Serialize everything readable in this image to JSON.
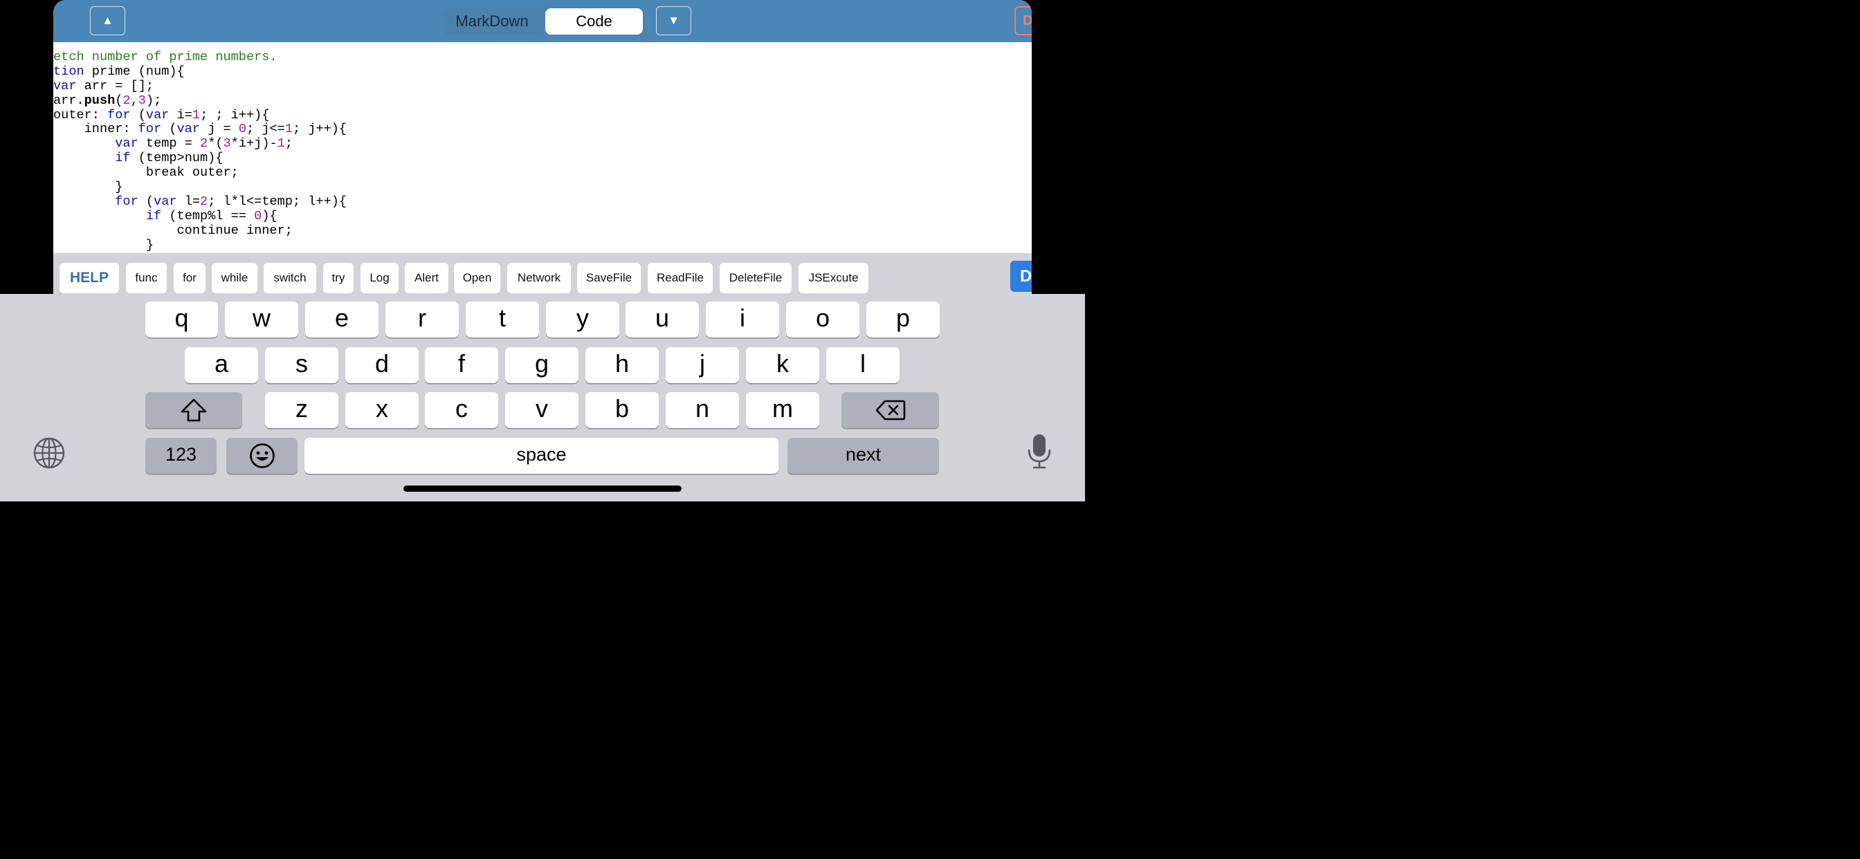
{
  "topbar": {
    "up_arrow": "▲",
    "down_arrow": "▼",
    "segments": [
      "MarkDown",
      "Code"
    ],
    "selected_segment": "Code",
    "corner_button_label": "D"
  },
  "code_lines": [
    [
      {
        "t": "etch number of prime numbers.",
        "c": "cm"
      }
    ],
    [
      {
        "t": "tion",
        "c": "kw"
      },
      {
        "t": " prime (num){",
        "c": ""
      }
    ],
    [
      {
        "t": "var",
        "c": "kw"
      },
      {
        "t": " arr = [];",
        "c": ""
      }
    ],
    [
      {
        "t": "arr.",
        "c": ""
      },
      {
        "t": "push",
        "c": "fn"
      },
      {
        "t": "(",
        "c": ""
      },
      {
        "t": "2",
        "c": "nm"
      },
      {
        "t": ",",
        "c": ""
      },
      {
        "t": "3",
        "c": "nm"
      },
      {
        "t": ");",
        "c": ""
      }
    ],
    [
      {
        "t": "outer: ",
        "c": ""
      },
      {
        "t": "for",
        "c": "kw"
      },
      {
        "t": " (",
        "c": ""
      },
      {
        "t": "var",
        "c": "kw"
      },
      {
        "t": " i=",
        "c": ""
      },
      {
        "t": "1",
        "c": "nm"
      },
      {
        "t": "; ; i++){",
        "c": ""
      }
    ],
    [
      {
        "t": "    inner: ",
        "c": ""
      },
      {
        "t": "for",
        "c": "kw"
      },
      {
        "t": " (",
        "c": ""
      },
      {
        "t": "var",
        "c": "kw"
      },
      {
        "t": " j = ",
        "c": ""
      },
      {
        "t": "0",
        "c": "nm"
      },
      {
        "t": "; j<=",
        "c": ""
      },
      {
        "t": "1",
        "c": "nm"
      },
      {
        "t": "; j++){",
        "c": ""
      }
    ],
    [
      {
        "t": "        ",
        "c": ""
      },
      {
        "t": "var",
        "c": "kw"
      },
      {
        "t": " temp = ",
        "c": ""
      },
      {
        "t": "2",
        "c": "nm"
      },
      {
        "t": "*(",
        "c": ""
      },
      {
        "t": "3",
        "c": "nm"
      },
      {
        "t": "*i+j)-",
        "c": ""
      },
      {
        "t": "1",
        "c": "nm"
      },
      {
        "t": ";",
        "c": ""
      }
    ],
    [
      {
        "t": "        ",
        "c": ""
      },
      {
        "t": "if",
        "c": "kw"
      },
      {
        "t": " (temp>num){",
        "c": ""
      }
    ],
    [
      {
        "t": "            break outer;",
        "c": ""
      }
    ],
    [
      {
        "t": "        }",
        "c": ""
      }
    ],
    [
      {
        "t": "        ",
        "c": ""
      },
      {
        "t": "for",
        "c": "kw"
      },
      {
        "t": " (",
        "c": ""
      },
      {
        "t": "var",
        "c": "kw"
      },
      {
        "t": " l=",
        "c": ""
      },
      {
        "t": "2",
        "c": "nm"
      },
      {
        "t": "; l*l<=temp; l++){",
        "c": ""
      }
    ],
    [
      {
        "t": "            ",
        "c": ""
      },
      {
        "t": "if",
        "c": "kw"
      },
      {
        "t": " (temp%l == ",
        "c": ""
      },
      {
        "t": "0",
        "c": "nm"
      },
      {
        "t": "){",
        "c": ""
      }
    ],
    [
      {
        "t": "                continue inner;",
        "c": ""
      }
    ],
    [
      {
        "t": "            }",
        "c": ""
      }
    ]
  ],
  "snippets": {
    "help": "HELP",
    "items": [
      "func",
      "for",
      "while",
      "switch",
      "try",
      "Log",
      "Alert",
      "Open",
      "Network",
      "SaveFile",
      "ReadFile",
      "DeleteFile",
      "JSExcute"
    ],
    "done_label": "D"
  },
  "keyboard": {
    "row1": [
      "q",
      "w",
      "e",
      "r",
      "t",
      "y",
      "u",
      "i",
      "o",
      "p"
    ],
    "row2": [
      "a",
      "s",
      "d",
      "f",
      "g",
      "h",
      "j",
      "k",
      "l"
    ],
    "row3": [
      "z",
      "x",
      "c",
      "v",
      "b",
      "n",
      "m"
    ],
    "numbers_label": "123",
    "space_label": "space",
    "return_label": "next",
    "colors": {
      "keyboard_bg": "#d1d3d9",
      "key": "#ffffff",
      "function_key": "#acb1bb"
    }
  },
  "colors": {
    "topbar": "#4a86b6",
    "comment": "#2e7d1e",
    "keyword": "#1010a8",
    "number": "#a0207a"
  }
}
